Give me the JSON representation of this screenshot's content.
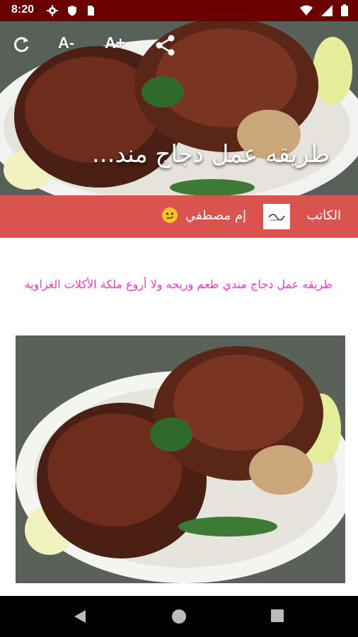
{
  "status_bar": {
    "time": "8:20",
    "left_icons": [
      "gear-icon",
      "shield-icon",
      "sim-card-icon"
    ],
    "right_icons": [
      "wifi-icon",
      "signal-icon",
      "battery-icon"
    ]
  },
  "toolbar": {
    "refresh_icon": "refresh-icon",
    "font_decrease_label": "A-",
    "font_increase_label": "A+",
    "share_icon": "share-icon"
  },
  "hero": {
    "title": "طريقه عمل دجاج مند..."
  },
  "author": {
    "label": "الكاتب",
    "name": "إم مصطفي",
    "emoji": "slightly-smiling-face"
  },
  "article": {
    "intro": "طريقه عمل دجاج مندي طعم وريحه ولا أروع ملكة الأكلات الغزاوية"
  },
  "nav_bar": {
    "icons": [
      "back-icon",
      "home-icon",
      "recents-icon"
    ]
  },
  "colors": {
    "status_bar": "#6a0000",
    "author_bar": "#d9534f",
    "intro_text": "#ff33cc"
  }
}
